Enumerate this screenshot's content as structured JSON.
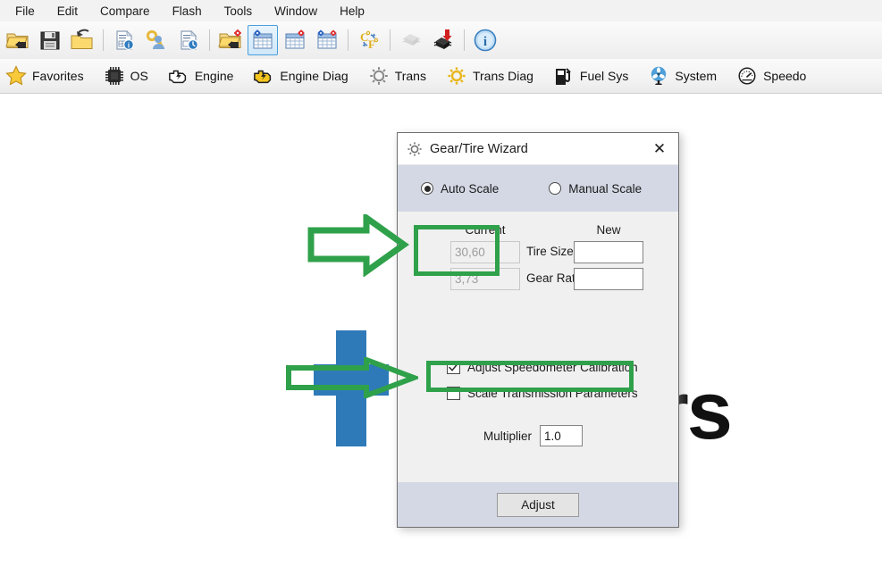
{
  "menubar": {
    "items": [
      {
        "label": "File"
      },
      {
        "label": "Edit"
      },
      {
        "label": "Compare"
      },
      {
        "label": "Flash"
      },
      {
        "label": "Tools"
      },
      {
        "label": "Window"
      },
      {
        "label": "Help"
      }
    ]
  },
  "toolbar": {
    "buttons": [
      {
        "name": "open-file-icon",
        "title": "Open"
      },
      {
        "name": "save-icon",
        "title": "Save"
      },
      {
        "name": "open-recent-icon",
        "title": "Open Recent"
      },
      {
        "name": "file-info-icon",
        "title": "File Info"
      },
      {
        "name": "key-user-icon",
        "title": "Licence"
      },
      {
        "name": "file-history-icon",
        "title": "History"
      },
      {
        "name": "open-definition-icon",
        "title": "Open Definition"
      },
      {
        "name": "table-settings-icon",
        "title": "Table",
        "selected": true
      },
      {
        "name": "table-compare-icon",
        "title": "Compare Table"
      },
      {
        "name": "table-multi-icon",
        "title": "Multi Table"
      },
      {
        "name": "celsius-fahrenheit-icon",
        "title": "C/F Convert"
      },
      {
        "name": "chip-read-icon",
        "title": "Read ECU",
        "disabled": true
      },
      {
        "name": "chip-flash-icon",
        "title": "Flash ECU"
      },
      {
        "name": "info-icon",
        "title": "About"
      }
    ]
  },
  "tabs": [
    {
      "label": "Favorites",
      "icon": "star-icon"
    },
    {
      "label": "OS",
      "icon": "chip-icon"
    },
    {
      "label": "Engine",
      "icon": "engine-icon"
    },
    {
      "label": "Engine Diag",
      "icon": "engine-diag-icon"
    },
    {
      "label": "Trans",
      "icon": "gear-icon"
    },
    {
      "label": "Trans Diag",
      "icon": "gear-diag-icon"
    },
    {
      "label": "Fuel Sys",
      "icon": "fuel-pump-icon"
    },
    {
      "label": "System",
      "icon": "fan-icon"
    },
    {
      "label": "Speedo",
      "icon": "speedometer-icon"
    }
  ],
  "watermark": {
    "text": "rs"
  },
  "dialog": {
    "title": "Gear/Tire Wizard",
    "close_label": "✕",
    "scale_mode": {
      "auto_label": "Auto Scale",
      "manual_label": "Manual Scale",
      "selected": "auto"
    },
    "columns": {
      "current_header": "Current",
      "new_header": "New"
    },
    "rows": [
      {
        "label": "Tire Size",
        "current_value": "30,60",
        "new_value": "",
        "current_disabled": true
      },
      {
        "label": "Gear Ratio",
        "current_value": "3,73",
        "new_value": "",
        "current_disabled": true
      }
    ],
    "checkboxes": [
      {
        "label": "Adjust Speedometer Calibration",
        "checked": true,
        "mark": "✓"
      },
      {
        "label": "Scale Transmission Parameters",
        "checked": false,
        "mark": ""
      }
    ],
    "multiplier": {
      "label": "Multiplier",
      "value": "1.0"
    },
    "adjust_button": "Adjust"
  },
  "annotations": {
    "arrow_color": "#2fa14a",
    "highlight_color": "#2fa14a",
    "arrow_1_target": "current-column",
    "arrow_2_target": "adjust-speedometer-calibration-checkbox"
  },
  "colors": {
    "accent_blue": "#2e7ab8",
    "dialog_band": "#d3d8e4",
    "dialog_body": "#f0f0f0",
    "green": "#2fa14a"
  }
}
